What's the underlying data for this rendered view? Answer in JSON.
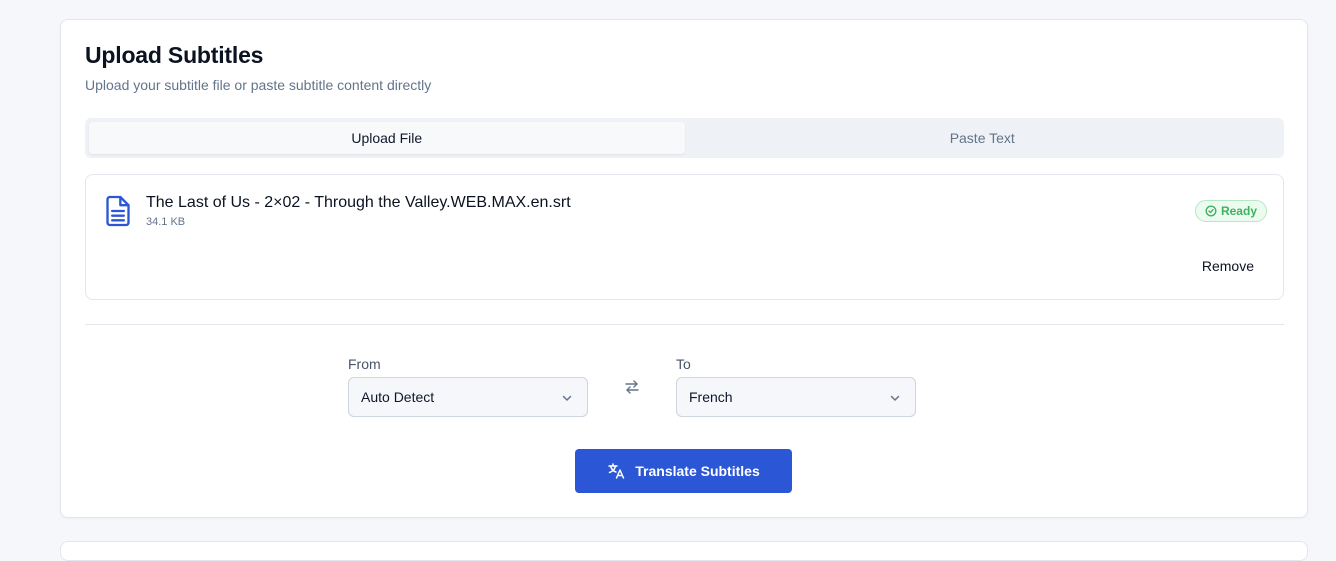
{
  "header": {
    "title": "Upload Subtitles",
    "subtitle": "Upload your subtitle file or paste subtitle content directly"
  },
  "tabs": [
    {
      "label": "Upload File",
      "active": true
    },
    {
      "label": "Paste Text",
      "active": false
    }
  ],
  "file": {
    "name": "The Last of Us - 2×02 - Through the Valley.WEB.MAX.en.srt",
    "size": "34.1 KB",
    "status": "Ready",
    "remove_label": "Remove",
    "icon": "file-text-icon"
  },
  "languages": {
    "from_label": "From",
    "from_value": "Auto Detect",
    "to_label": "To",
    "to_value": "French"
  },
  "actions": {
    "translate_label": "Translate Subtitles"
  },
  "colors": {
    "accent": "#2b56d5",
    "ready_green": "#3fb35f",
    "file_icon": "#2b56d5"
  }
}
